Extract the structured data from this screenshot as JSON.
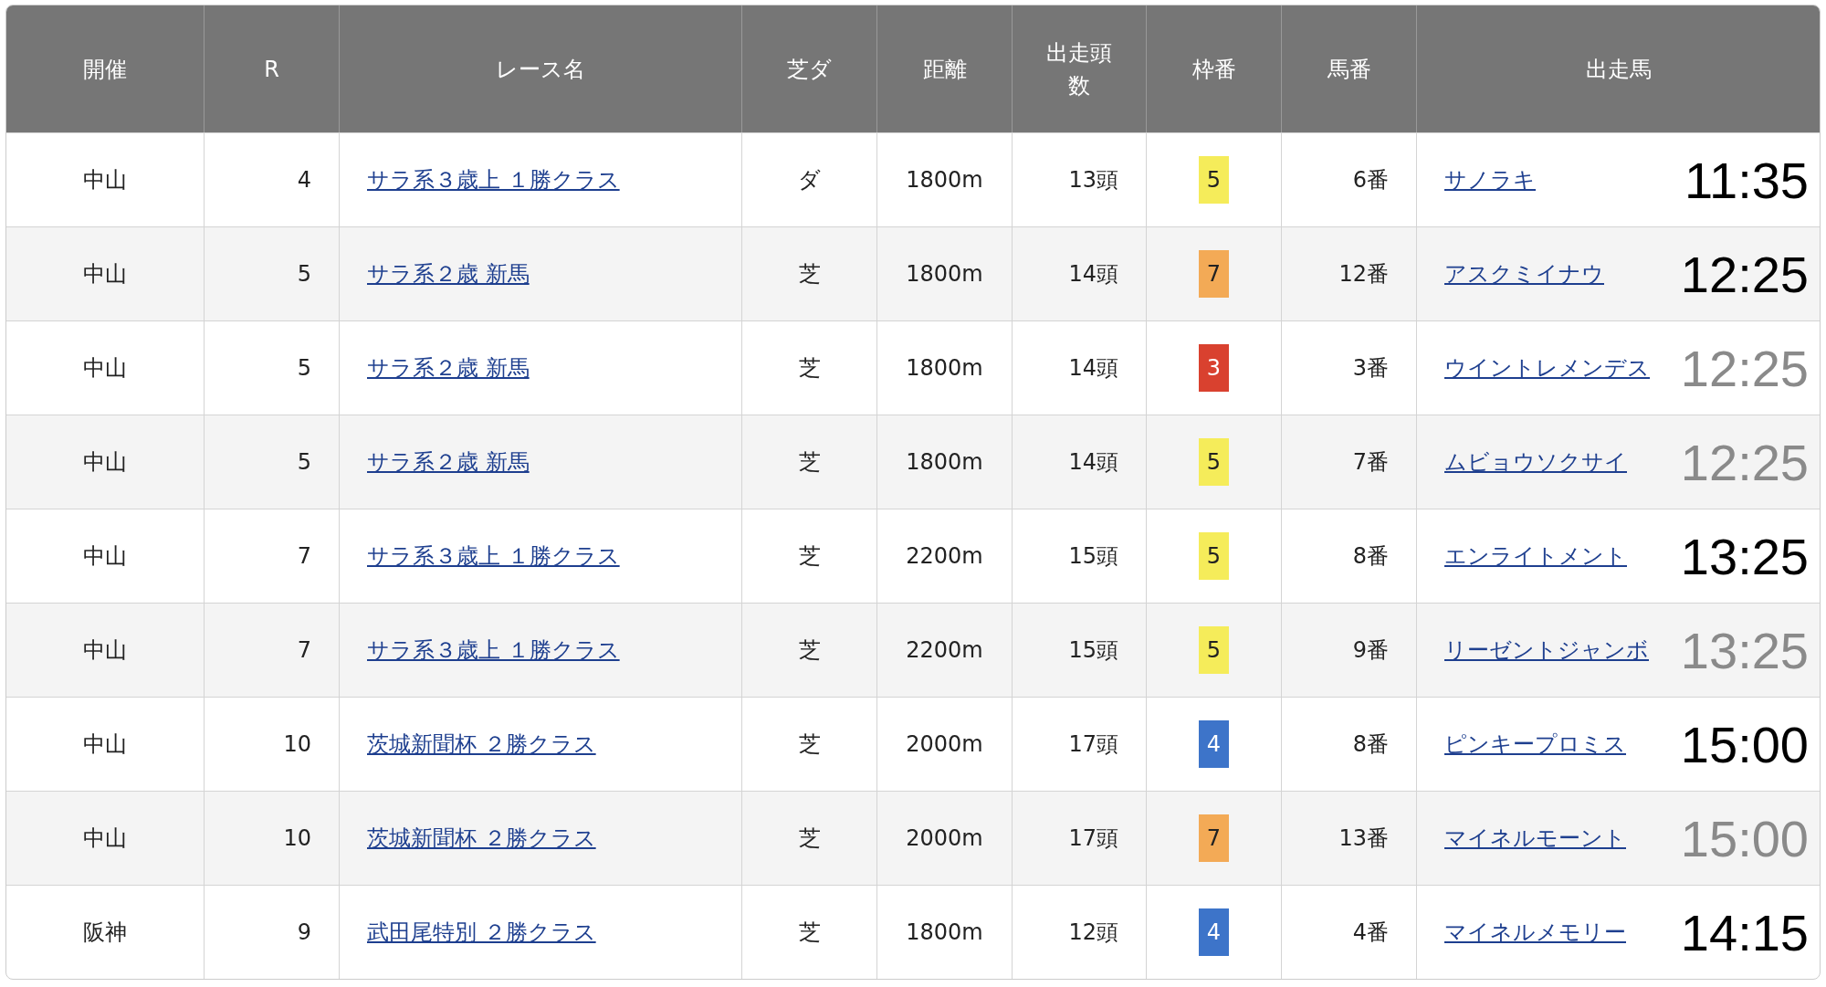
{
  "table": {
    "columns": [
      "開催",
      "R",
      "レース名",
      "芝ダ",
      "距離",
      "出走頭数",
      "枠番",
      "馬番",
      "出走馬"
    ],
    "rows": [
      {
        "venue": "中山",
        "race": "4",
        "race_name": "サラ系３歳上 １勝クラス",
        "surface": "ダ",
        "distance": "1800m",
        "runners": "13頭",
        "frame": {
          "number": "5",
          "color": "#f5ec5a"
        },
        "horse_no": "6番",
        "horse": "サノラキ",
        "time": "11:35",
        "dimmed": false
      },
      {
        "venue": "中山",
        "race": "5",
        "race_name": "サラ系２歳 新馬",
        "surface": "芝",
        "distance": "1800m",
        "runners": "14頭",
        "frame": {
          "number": "7",
          "color": "#f3aa56"
        },
        "horse_no": "12番",
        "horse": "アスクミイナウ",
        "time": "12:25",
        "dimmed": false
      },
      {
        "venue": "中山",
        "race": "5",
        "race_name": "サラ系２歳 新馬",
        "surface": "芝",
        "distance": "1800m",
        "runners": "14頭",
        "frame": {
          "number": "3",
          "color": "#d9412f"
        },
        "horse_no": "3番",
        "horse": "ウイントレメンデス",
        "time": "12:25",
        "dimmed": true
      },
      {
        "venue": "中山",
        "race": "5",
        "race_name": "サラ系２歳 新馬",
        "surface": "芝",
        "distance": "1800m",
        "runners": "14頭",
        "frame": {
          "number": "5",
          "color": "#f5ec5a"
        },
        "horse_no": "7番",
        "horse": "ムビョウソクサイ",
        "time": "12:25",
        "dimmed": true
      },
      {
        "venue": "中山",
        "race": "7",
        "race_name": "サラ系３歳上 １勝クラス",
        "surface": "芝",
        "distance": "2200m",
        "runners": "15頭",
        "frame": {
          "number": "5",
          "color": "#f5ec5a"
        },
        "horse_no": "8番",
        "horse": "エンライトメント",
        "time": "13:25",
        "dimmed": false
      },
      {
        "venue": "中山",
        "race": "7",
        "race_name": "サラ系３歳上 １勝クラス",
        "surface": "芝",
        "distance": "2200m",
        "runners": "15頭",
        "frame": {
          "number": "5",
          "color": "#f5ec5a"
        },
        "horse_no": "9番",
        "horse": "リーゼントジャンボ",
        "time": "13:25",
        "dimmed": true
      },
      {
        "venue": "中山",
        "race": "10",
        "race_name": "茨城新聞杯 ２勝クラス",
        "surface": "芝",
        "distance": "2000m",
        "runners": "17頭",
        "frame": {
          "number": "4",
          "color": "#3d74c9"
        },
        "horse_no": "8番",
        "horse": "ピンキープロミス",
        "time": "15:00",
        "dimmed": false
      },
      {
        "venue": "中山",
        "race": "10",
        "race_name": "茨城新聞杯 ２勝クラス",
        "surface": "芝",
        "distance": "2000m",
        "runners": "17頭",
        "frame": {
          "number": "7",
          "color": "#f3aa56"
        },
        "horse_no": "13番",
        "horse": "マイネルモーント",
        "time": "15:00",
        "dimmed": true
      },
      {
        "venue": "阪神",
        "race": "9",
        "race_name": "武田尾特別 ２勝クラス",
        "surface": "芝",
        "distance": "1800m",
        "runners": "12頭",
        "frame": {
          "number": "4",
          "color": "#3d74c9"
        },
        "horse_no": "4番",
        "horse": "マイネルメモリー",
        "time": "14:15",
        "dimmed": false
      }
    ]
  }
}
